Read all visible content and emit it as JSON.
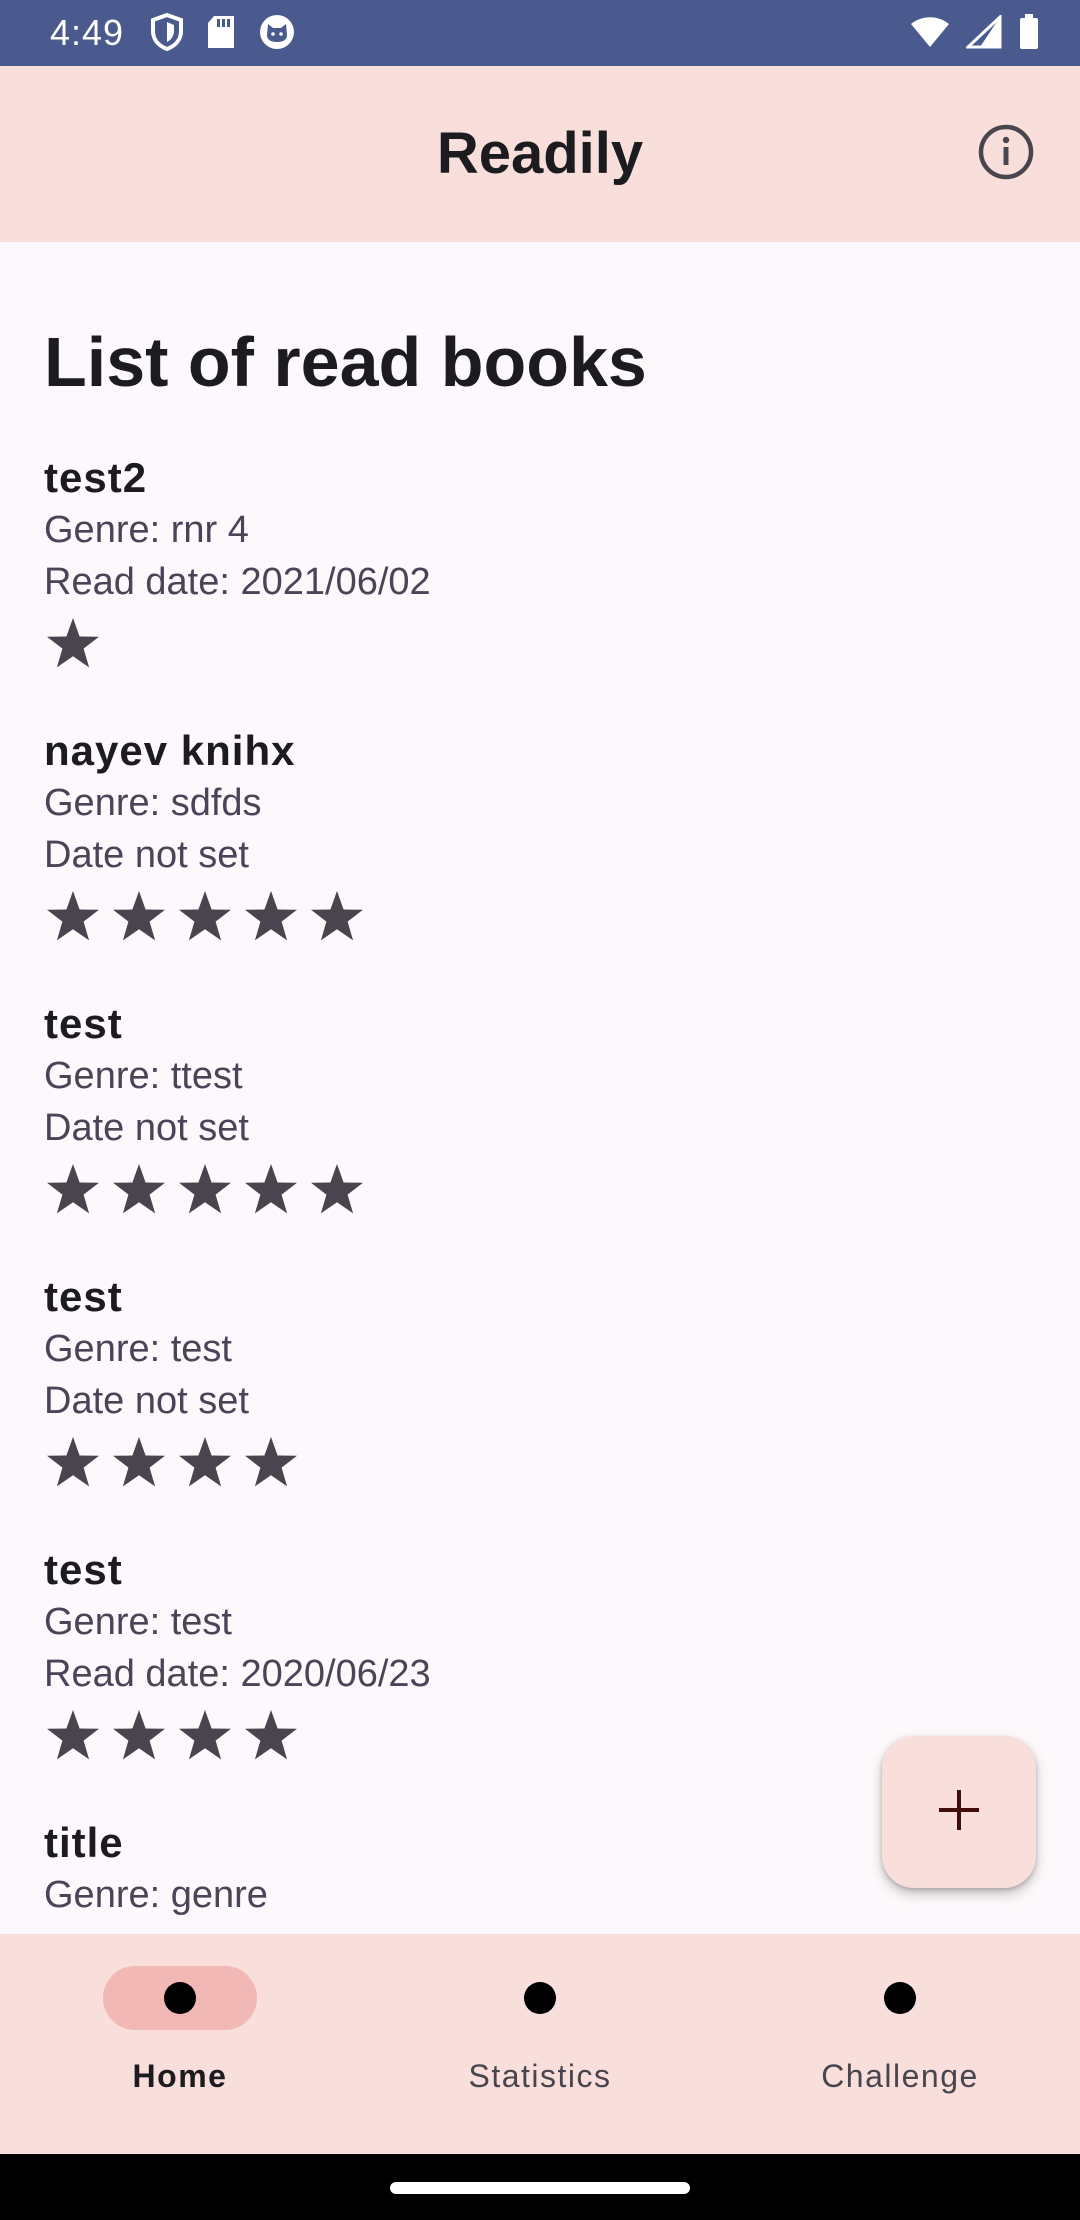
{
  "status_bar": {
    "time": "4:49",
    "left_icons": [
      "shield-icon",
      "sd-card-icon",
      "cat-icon"
    ],
    "right_icons": [
      "wifi-icon",
      "signal-icon",
      "battery-icon"
    ],
    "color": "#4a5a8f"
  },
  "app_bar": {
    "title": "Readily",
    "info_icon": "info-icon",
    "color": "#f9dfdc"
  },
  "main": {
    "heading": "List of read books",
    "books": [
      {
        "title": "test2",
        "genre": "Genre: rnr 4",
        "date": "Read date: 2021/06/02",
        "rating": 1
      },
      {
        "title": "nayev knihx",
        "genre": "Genre: sdfds",
        "date": "Date not set",
        "rating": 5
      },
      {
        "title": "test",
        "genre": "Genre: ttest",
        "date": "Date not set",
        "rating": 5
      },
      {
        "title": "test",
        "genre": "Genre: test",
        "date": "Date not set",
        "rating": 4
      },
      {
        "title": "test",
        "genre": "Genre: test",
        "date": "Read date: 2020/06/23",
        "rating": 4
      },
      {
        "title": "title",
        "genre": "Genre: genre",
        "date": "",
        "rating": 0
      }
    ],
    "star_color": "#49454f"
  },
  "fab": {
    "icon": "plus-icon"
  },
  "bottom_nav": {
    "items": [
      {
        "label": "Home",
        "active": true
      },
      {
        "label": "Statistics",
        "active": false
      },
      {
        "label": "Challenge",
        "active": false
      }
    ],
    "active_indicator_color": "#f2b8b5"
  }
}
